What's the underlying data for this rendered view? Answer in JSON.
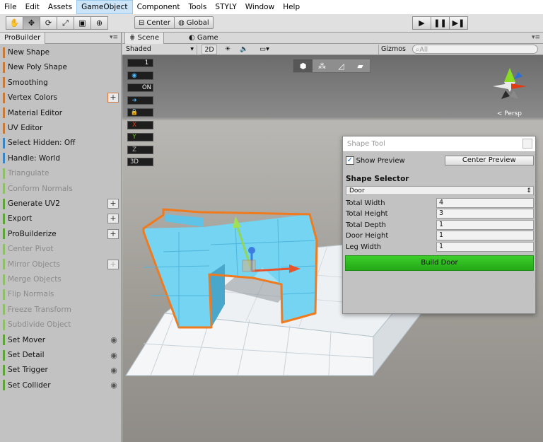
{
  "menu": [
    "File",
    "Edit",
    "Assets",
    "GameObject",
    "Component",
    "Tools",
    "STYLY",
    "Window",
    "Help"
  ],
  "menu_active": "GameObject",
  "toolbar": {
    "pivot_label": "Center",
    "space_label": "Global"
  },
  "probuilder": {
    "tab_title": "ProBuilder",
    "items": [
      {
        "label": "New Shape",
        "color": "#c87a3a",
        "disabled": false,
        "extra": ""
      },
      {
        "label": "New Poly Shape",
        "color": "#c87a3a",
        "disabled": false,
        "extra": ""
      },
      {
        "label": "Smoothing",
        "color": "#c87a3a",
        "disabled": false,
        "extra": ""
      },
      {
        "label": "Vertex Colors",
        "color": "#c87a3a",
        "disabled": false,
        "extra": "plus-orange"
      },
      {
        "label": "Material Editor",
        "color": "#c87a3a",
        "disabled": false,
        "extra": ""
      },
      {
        "label": "UV Editor",
        "color": "#c87a3a",
        "disabled": false,
        "extra": ""
      },
      {
        "label": "Select Hidden: Off",
        "color": "#3a86c4",
        "disabled": false,
        "extra": ""
      },
      {
        "label": "Handle: World",
        "color": "#3a86c4",
        "disabled": false,
        "extra": ""
      },
      {
        "label": "Triangulate",
        "color": "#8fbf6a",
        "disabled": true,
        "extra": ""
      },
      {
        "label": "Conform Normals",
        "color": "#8fbf6a",
        "disabled": true,
        "extra": ""
      },
      {
        "label": "Generate UV2",
        "color": "#5ea63a",
        "disabled": false,
        "extra": "plus"
      },
      {
        "label": "Export",
        "color": "#5ea63a",
        "disabled": false,
        "extra": "plus"
      },
      {
        "label": "ProBuilderize",
        "color": "#5ea63a",
        "disabled": false,
        "extra": "plus"
      },
      {
        "label": "Center Pivot",
        "color": "#8fbf6a",
        "disabled": true,
        "extra": ""
      },
      {
        "label": "Mirror Objects",
        "color": "#8fbf6a",
        "disabled": true,
        "extra": "plus-dim"
      },
      {
        "label": "Merge Objects",
        "color": "#8fbf6a",
        "disabled": true,
        "extra": ""
      },
      {
        "label": "Flip Normals",
        "color": "#8fbf6a",
        "disabled": true,
        "extra": ""
      },
      {
        "label": "Freeze Transform",
        "color": "#8fbf6a",
        "disabled": true,
        "extra": ""
      },
      {
        "label": "Subdivide Object",
        "color": "#8fbf6a",
        "disabled": true,
        "extra": ""
      },
      {
        "label": "Set Mover",
        "color": "#5ea63a",
        "disabled": false,
        "extra": "eye"
      },
      {
        "label": "Set Detail",
        "color": "#5ea63a",
        "disabled": false,
        "extra": "eye"
      },
      {
        "label": "Set Trigger",
        "color": "#5ea63a",
        "disabled": false,
        "extra": "eye"
      },
      {
        "label": "Set Collider",
        "color": "#5ea63a",
        "disabled": false,
        "extra": "eye"
      }
    ]
  },
  "scene": {
    "tabs": [
      "Scene",
      "Game"
    ],
    "shading": "Shaded",
    "mode_2d": "2D",
    "gizmos": "Gizmos",
    "search_placeholder": "All",
    "persp_label": "Persp",
    "badges": [
      {
        "key": "",
        "value": "1"
      },
      {
        "key": "eye-icon",
        "value": ""
      },
      {
        "key": "",
        "value": "ON"
      },
      {
        "key": "arrow-icon",
        "value": ""
      },
      {
        "key": "lock-icon",
        "value": ""
      },
      {
        "key": "X",
        "value": ""
      },
      {
        "key": "Y",
        "value": ""
      },
      {
        "key": "Z",
        "value": ""
      },
      {
        "key": "3D",
        "value": ""
      }
    ]
  },
  "shape_tool": {
    "title": "Shape Tool",
    "show_preview_label": "Show Preview",
    "show_preview_checked": true,
    "center_preview_label": "Center Preview",
    "shape_selector_label": "Shape Selector",
    "selected_shape": "Door",
    "fields": [
      {
        "label": "Total Width",
        "value": "4"
      },
      {
        "label": "Total Height",
        "value": "3"
      },
      {
        "label": "Total Depth",
        "value": "1"
      },
      {
        "label": "Door Height",
        "value": "1"
      },
      {
        "label": "Leg Width",
        "value": "1"
      }
    ],
    "build_label": "Build Door"
  },
  "colors": {
    "accent_green": "#2cba1e",
    "selection_orange": "#f07a1e",
    "door_cyan": "#66d4f4"
  }
}
